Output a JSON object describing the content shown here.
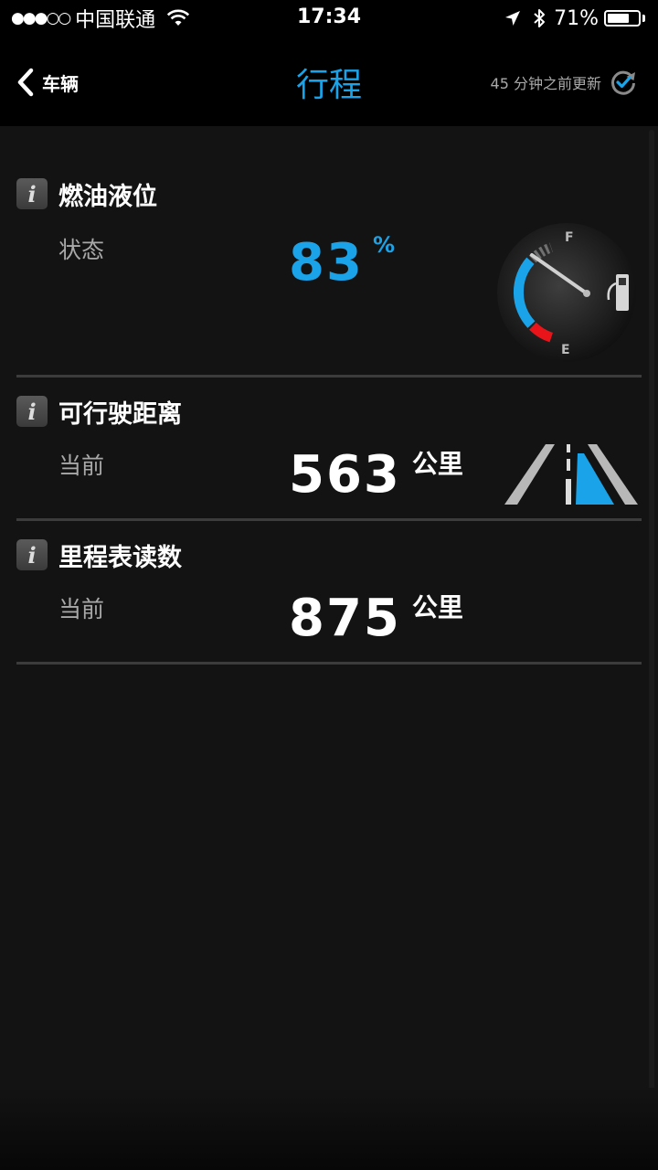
{
  "status_bar": {
    "signal": "●●●○○",
    "carrier": "中国联通",
    "time": "17:34",
    "battery_percent": "71%",
    "battery_level": 0.71
  },
  "nav": {
    "back_label": "车辆",
    "title": "行程",
    "updated_text": "45 分钟之前更新"
  },
  "fuel": {
    "title": "燃油液位",
    "label": "状态",
    "value": "83",
    "unit": "%",
    "gauge_full": "F",
    "gauge_empty": "E"
  },
  "range": {
    "title": "可行驶距离",
    "label": "当前",
    "value": "563",
    "unit": "公里"
  },
  "odometer": {
    "title": "里程表读数",
    "label": "当前",
    "value": "875",
    "unit": "公里"
  },
  "colors": {
    "accent": "#1aa3e8",
    "danger": "#e8141a",
    "background": "#131313"
  }
}
